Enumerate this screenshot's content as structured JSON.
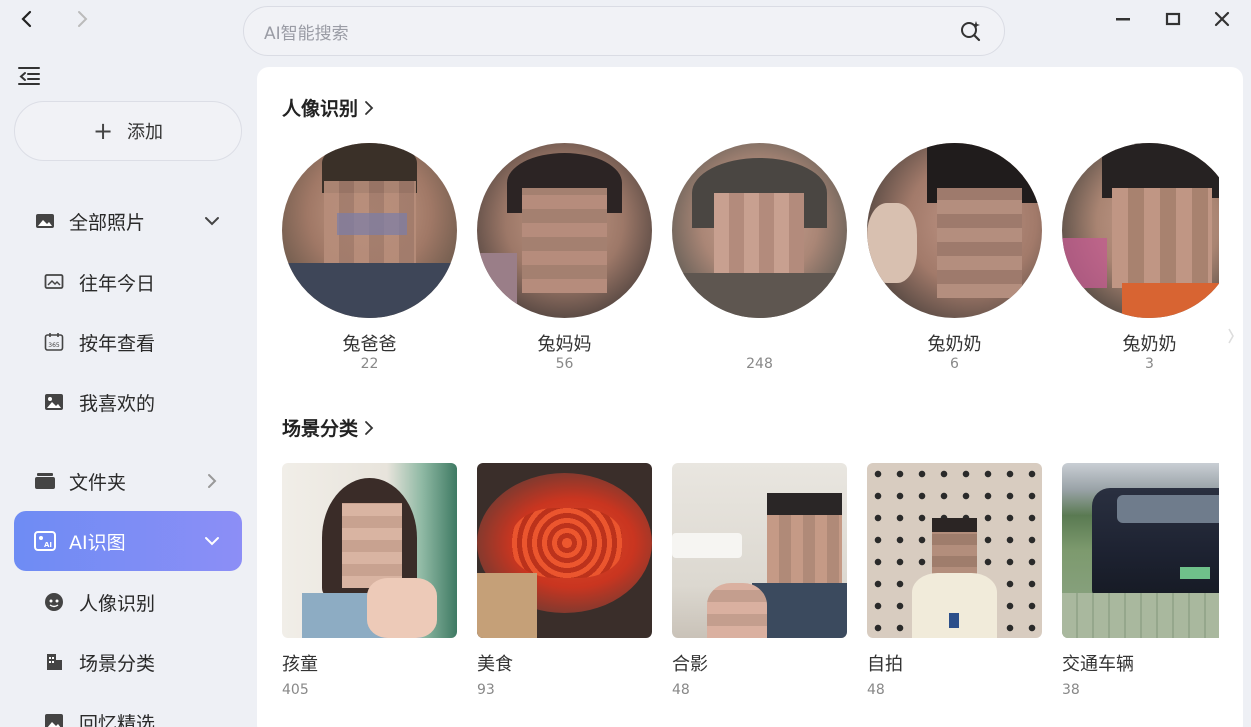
{
  "search": {
    "placeholder": "AI智能搜索"
  },
  "sidebar": {
    "add_label": "添加",
    "items": [
      {
        "label": "全部照片"
      },
      {
        "label": "往年今日"
      },
      {
        "label": "按年查看"
      },
      {
        "label": "我喜欢的"
      },
      {
        "label": "文件夹"
      },
      {
        "label": "AI识图"
      },
      {
        "label": "人像识别"
      },
      {
        "label": "场景分类"
      },
      {
        "label": "回忆精选"
      }
    ]
  },
  "main": {
    "faces_title": "人像识别",
    "faces": [
      {
        "name": "兔爸爸",
        "count": "22"
      },
      {
        "name": "兔妈妈",
        "count": "56"
      },
      {
        "name": "",
        "count": "248"
      },
      {
        "name": "兔奶奶",
        "count": "6"
      },
      {
        "name": "兔奶奶",
        "count": "3"
      }
    ],
    "scenes_title": "场景分类",
    "scenes": [
      {
        "name": "孩童",
        "count": "405"
      },
      {
        "name": "美食",
        "count": "93"
      },
      {
        "name": "合影",
        "count": "48"
      },
      {
        "name": "自拍",
        "count": "48"
      },
      {
        "name": "交通车辆",
        "count": "38"
      }
    ]
  },
  "colors": {
    "accent_start": "#6e8cf4",
    "accent_end": "#8c8ef6",
    "background": "#eef0f5"
  }
}
